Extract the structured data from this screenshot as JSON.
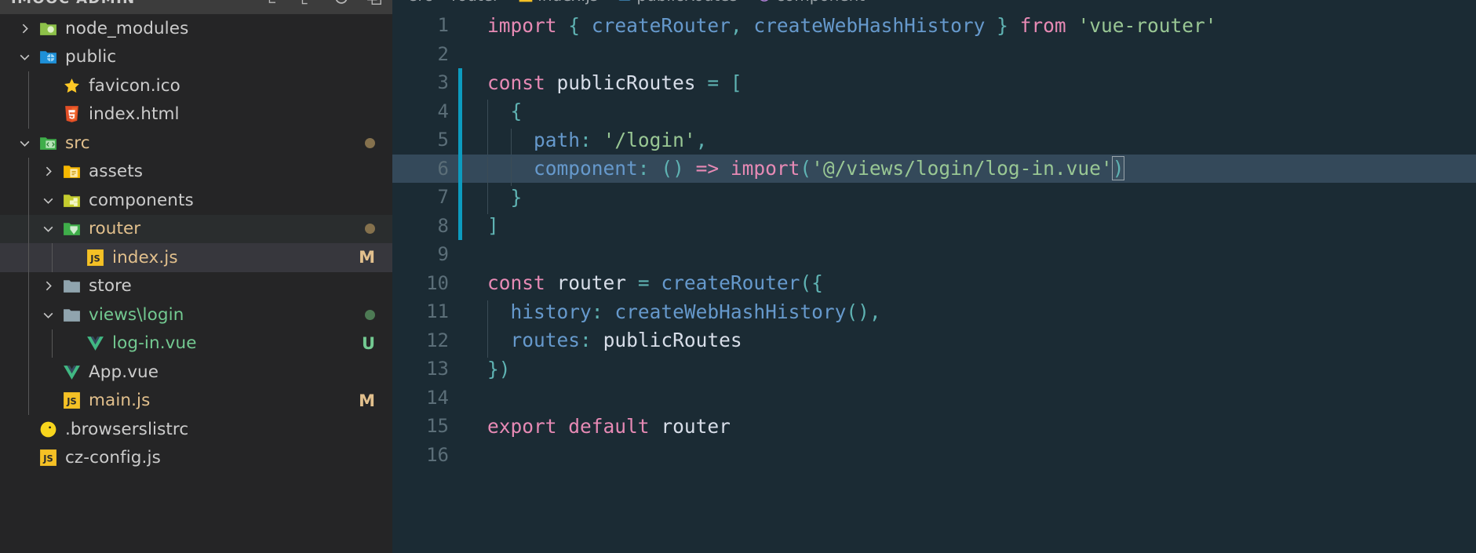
{
  "sidebar": {
    "title": "IMOOC ADMIN",
    "actions": [
      {
        "name": "new-file-icon",
        "label": "New File"
      },
      {
        "name": "new-folder-icon",
        "label": "New Folder"
      },
      {
        "name": "refresh-icon",
        "label": "Refresh Explorer"
      },
      {
        "name": "collapse-all-icon",
        "label": "Collapse Folders in Explorer"
      }
    ],
    "items": [
      {
        "label": "node_modules",
        "icon": "folder-node-icon",
        "type": "folder",
        "state": "collapsed",
        "depth": 0,
        "badge": "",
        "status": ""
      },
      {
        "label": "public",
        "icon": "folder-public-icon",
        "type": "folder",
        "state": "expanded",
        "depth": 0,
        "badge": "",
        "status": ""
      },
      {
        "label": "favicon.ico",
        "icon": "favicon-star-icon",
        "type": "file",
        "state": "",
        "depth": 1,
        "badge": "",
        "status": ""
      },
      {
        "label": "index.html",
        "icon": "html5-icon",
        "type": "file",
        "state": "",
        "depth": 1,
        "badge": "",
        "status": ""
      },
      {
        "label": "src",
        "icon": "folder-src-icon",
        "type": "folder",
        "state": "expanded",
        "depth": 0,
        "badge": "",
        "status": "modified"
      },
      {
        "label": "assets",
        "icon": "folder-assets-icon",
        "type": "folder",
        "state": "collapsed",
        "depth": 1,
        "badge": "",
        "status": ""
      },
      {
        "label": "components",
        "icon": "folder-components-icon",
        "type": "folder",
        "state": "expanded",
        "depth": 1,
        "badge": "",
        "status": ""
      },
      {
        "label": "router",
        "icon": "folder-router-icon",
        "type": "folder",
        "state": "expanded",
        "depth": 1,
        "badge": "",
        "status": "modified"
      },
      {
        "label": "index.js",
        "icon": "javascript-icon",
        "type": "file",
        "state": "",
        "depth": 2,
        "badge": "M",
        "status": "modified"
      },
      {
        "label": "store",
        "icon": "folder-icon",
        "type": "folder",
        "state": "collapsed",
        "depth": 1,
        "badge": "",
        "status": ""
      },
      {
        "label": "views\\login",
        "icon": "folder-open-icon",
        "type": "folder",
        "state": "expanded",
        "depth": 1,
        "badge": "",
        "status": "untracked"
      },
      {
        "label": "log-in.vue",
        "icon": "vue-icon",
        "type": "file",
        "state": "",
        "depth": 2,
        "badge": "U",
        "status": "untracked"
      },
      {
        "label": "App.vue",
        "icon": "vue-icon",
        "type": "file",
        "state": "",
        "depth": 1,
        "badge": "",
        "status": ""
      },
      {
        "label": "main.js",
        "icon": "javascript-icon",
        "type": "file",
        "state": "",
        "depth": 1,
        "badge": "M",
        "status": "modified"
      },
      {
        "label": ".browserslistrc",
        "icon": "browserslist-icon",
        "type": "file",
        "state": "",
        "depth": 0,
        "badge": "",
        "status": ""
      },
      {
        "label": "cz-config.js",
        "icon": "javascript-icon",
        "type": "file",
        "state": "",
        "depth": 0,
        "badge": "",
        "status": ""
      }
    ],
    "selected_item": "index.js",
    "colors": {
      "background": "#252526",
      "header_background": "#3c3c3c",
      "selected_row": "#37373d",
      "modified_text": "#e2c08d",
      "untracked_text": "#73c991"
    }
  },
  "editor": {
    "breadcrumb": [
      {
        "label": "src",
        "icon": ""
      },
      {
        "label": "router",
        "icon": ""
      },
      {
        "label": "index.js",
        "icon": "javascript-icon"
      },
      {
        "label": "publicRoutes",
        "icon": "array-symbol-icon"
      },
      {
        "label": "component",
        "icon": "field-symbol-icon"
      }
    ],
    "colors": {
      "background": "#1b2b34",
      "current_line": "#34495a",
      "line_number": "#5b6e78",
      "git_modified_bar": "#0c9bbf",
      "keyword": "#e78ab5",
      "string": "#99c794",
      "function": "#6699cc",
      "punctuation": "#5fb3b3",
      "plain": "#d8dee9"
    },
    "current_line_number": 6,
    "lines": [
      {
        "n": 1,
        "text": "import { createRouter, createWebHashHistory } from 'vue-router'",
        "git_modified": false,
        "indent": 0
      },
      {
        "n": 2,
        "text": "",
        "git_modified": false,
        "indent": 0
      },
      {
        "n": 3,
        "text": "const publicRoutes = [",
        "git_modified": true,
        "indent": 0
      },
      {
        "n": 4,
        "text": "  {",
        "git_modified": true,
        "indent": 1
      },
      {
        "n": 5,
        "text": "    path: '/login',",
        "git_modified": true,
        "indent": 2
      },
      {
        "n": 6,
        "text": "    component: () => import('@/views/login/log-in.vue')",
        "git_modified": true,
        "indent": 2
      },
      {
        "n": 7,
        "text": "  }",
        "git_modified": true,
        "indent": 1
      },
      {
        "n": 8,
        "text": "]",
        "git_modified": true,
        "indent": 0
      },
      {
        "n": 9,
        "text": "",
        "git_modified": false,
        "indent": 0
      },
      {
        "n": 10,
        "text": "const router = createRouter({",
        "git_modified": false,
        "indent": 0
      },
      {
        "n": 11,
        "text": "  history: createWebHashHistory(),",
        "git_modified": false,
        "indent": 1
      },
      {
        "n": 12,
        "text": "  routes: publicRoutes",
        "git_modified": false,
        "indent": 1
      },
      {
        "n": 13,
        "text": "})",
        "git_modified": false,
        "indent": 0
      },
      {
        "n": 14,
        "text": "",
        "git_modified": false,
        "indent": 0
      },
      {
        "n": 15,
        "text": "export default router",
        "git_modified": false,
        "indent": 0
      },
      {
        "n": 16,
        "text": "",
        "git_modified": false,
        "indent": 0
      }
    ]
  }
}
